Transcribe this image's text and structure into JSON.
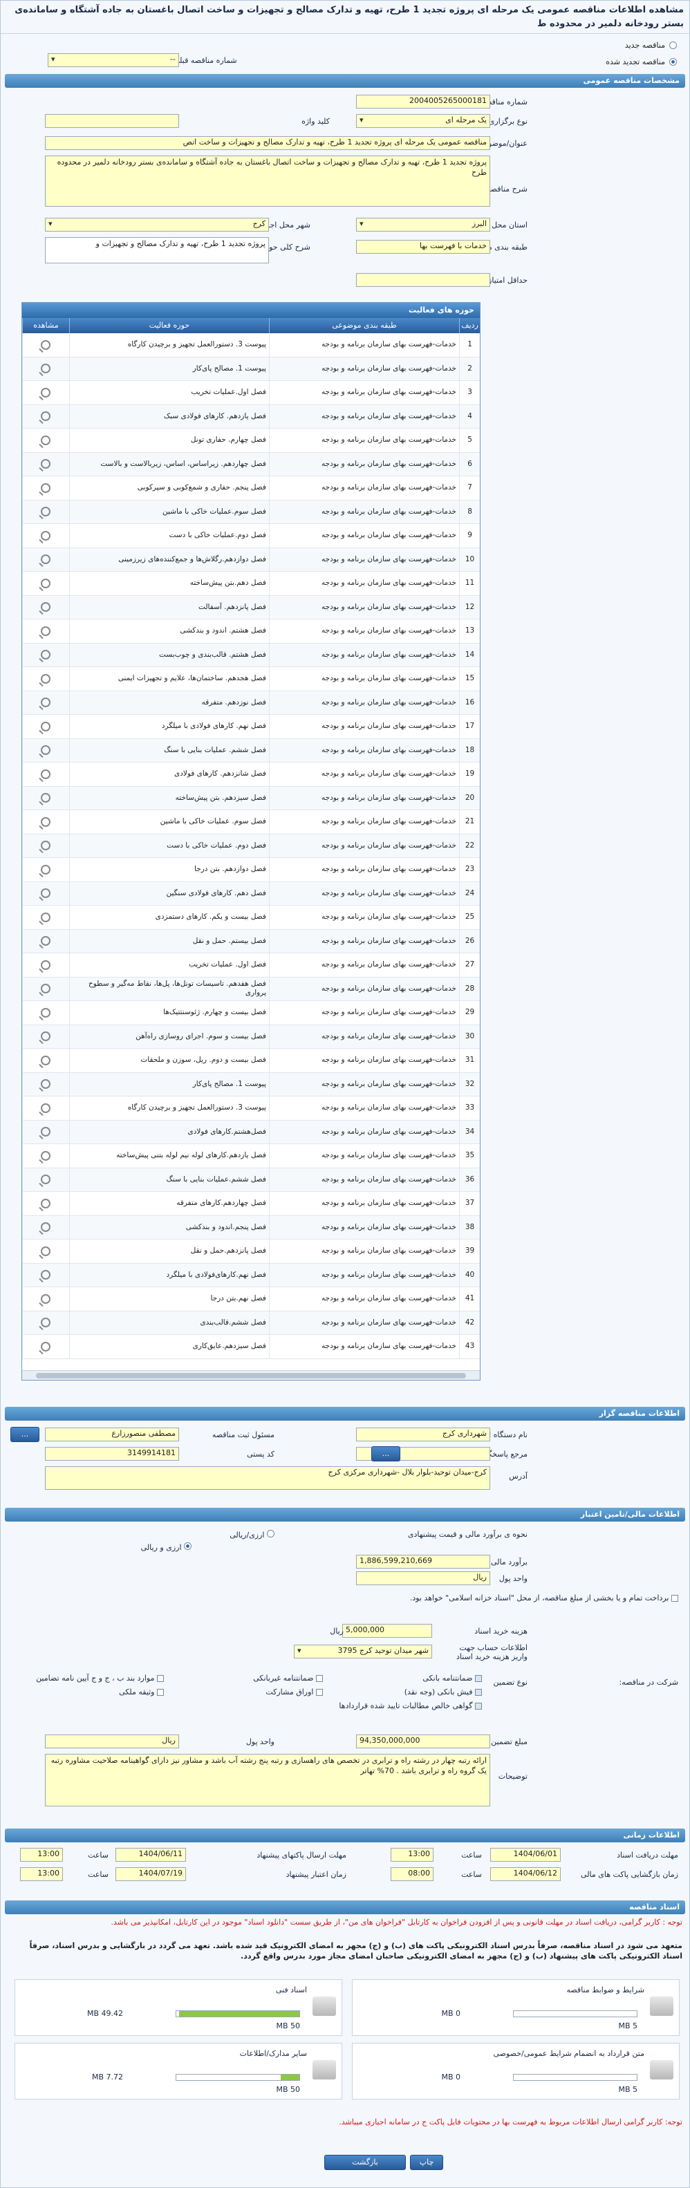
{
  "title": "مشاهده اطلاعات مناقصه عمومی یک مرحله ای پروژه تجدید 1 طرح، تهیه و تدارک مصالح و تجهیزات و ساخت اتصال باغستان به جاده آشتگاه و سامانده‌ی بستر رودخانه دلمیر در محدوده ط",
  "radios": {
    "new": "مناقصه جدید",
    "renewed": "مناقصه تجدید شده",
    "prev_label": "شماره مناقصه قبلی",
    "prev_value": "--"
  },
  "sections": {
    "general": "مشخصات مناقصه عمومی",
    "org": "اطلاعات مناقصه گزار",
    "finance": "اطلاعات مالی/تامین اعتبار",
    "timing": "اطلاعات زمانی",
    "docs": "اسناد مناقصه"
  },
  "general": {
    "number_label": "شماره مناقصه",
    "number": "2004005265000181",
    "type_label": "نوع برگزاری",
    "type": "یک مرحله ای",
    "keyword_label": "کلید واژه",
    "keyword": "",
    "subject_label": "عنوان/موضوع مناقصه",
    "subject": "مناقصه عمومی یک مرحله ای پروژه تجدید 1 طرح، تهیه و تدارک مصالح و تجهیزات و ساخت اتص",
    "desc_label": "شرح مناقصه",
    "desc": "پروژه تجدید 1 طرح، تهیه و تدارک مصالح و تجهیزات و ساخت اتصال باغستان به جاده آشتگاه و سامانده‌ی بستر رودخانه دلمیر در محدوده طرح",
    "province_label": "استان محل اجرا",
    "province": "البرز",
    "city_label": "شهر محل اجرا",
    "city": "کرج",
    "category_label": "طبقه بندی موضوعی",
    "category": "خدمات با فهرست بها",
    "scope_label": "شرح کلی حوزه فعالیت",
    "scope": "پروژه تجدید 1 طرح، تهیه و تدارک مصالح و تجهیزات و",
    "minscore_label": "حداقل امتیاز قابل قبول ارزیابی فنی/بازرگانی",
    "minscore": ""
  },
  "grid": {
    "title": "حوزه های فعالیت",
    "cols": [
      "ردیف",
      "طبقه بندی موضوعی",
      "حوزه فعالیت",
      "مشاهده"
    ],
    "cat": "خدمات-فهرست بهای سازمان برنامه و بودجه",
    "rows": [
      "پیوست 3. دستورالعمل تجهیز و برچیدن کارگاه",
      "پیوست 1. مصالح پای‌کار",
      "فصل اول.عملیات تخریب",
      "فصل یازدهم. کارهای فولادی سبک",
      "فصل چهارم. حفاری تونل",
      "فصل چهاردهم. زیراساس، اساس، زیربالاست و بالاست",
      "فصل پنجم. حفاری و شمع‌کوبی و سپرکوبی",
      "فصل سوم.عملیات خاکی با ماشین",
      "فصل دوم.عملیات خاکی با دست",
      "فصل دوازدهم.رگلاش‌ها و جمع‌کننده‌های زیرزمینی",
      "فصل دهم.بتن پیش‌ساخته",
      "فصل پانزدهم. آسفالت",
      "فصل هشتم. اندود و بندکشی",
      "فصل هشتم. قالب‌بندی و چوب‌بست",
      "فصل هجدهم. ساختمان‌ها، علایم و تجهیزات ایمنی",
      "فصل نوزدهم. متفرقه",
      "فصل نهم. کارهای فولادی با میلگرد",
      "فصل ششم. عملیات بنایی با سنگ",
      "فصل شانزدهم. کارهای فولادی",
      "فصل سیزدهم. بتن پیش‌ساخته",
      "فصل سوم. عملیات خاکی با ماشین",
      "فصل دوم. عملیات خاکی با دست",
      "فصل دوازدهم. بتن درجا",
      "فصل دهم. کارهای فولادی سنگین",
      "فصل بیست و یکم. کارهای دستمزدی",
      "فصل بیستم. حمل و نقل",
      "فصل اول. عملیات تخریب",
      "فصل هفدهم. تاسیسات تونل‌ها، پل‌ها، نقاط مه‌گیر و سطوح پرواری",
      "فصل بیست و چهارم. ژئوسنتتیک‌ها",
      "فصل بیست و سوم. اجرای روسازی راه‌آهن",
      "فصل بیست و دوم. ریل، سوزن و ملحقات",
      "پیوست 1. مصالح پای‌کار",
      "پیوست 3. دستورالعمل تجهیز و برچیدن کارگاه",
      "فصل‌هشتم.کارهای فولادی",
      "فصل یازدهم.کارهای لوله نیم لوله بتنی پیش‌ساخته",
      "فصل ششم.عملیات بنایی با سنگ",
      "فصل چهاردهم.کارهای متفرقه",
      "فصل پنجم.اندود و بندکشی",
      "فصل پانزدهم.حمل و نقل",
      "فصل نهم.کارهای‌فولادی با میلگرد",
      "فصل نهم.بتن درجا",
      "فصل ششم.قالب‌بندی",
      "فصل سیزدهم.عایق‌کاری"
    ]
  },
  "org": {
    "name_label": "نام دستگاه اجرایی مناقصه گزار",
    "name": "شهرداری کرج",
    "resp_label": "مسئول ثبت مناقصه",
    "resp": "مصطفی منصورزارع",
    "ref_label": "مرجع پاسخگویی",
    "ref": "",
    "postal_label": "کد پستی",
    "postal": "3149914181",
    "addr_label": "آدرس",
    "addr": "کرج-میدان توحید-بلوار بلال -شهرداری مرکزی کرج",
    "btn": "..."
  },
  "finance": {
    "method_label": "نحوه ی برآورد مالی و قیمت پیشنهادی",
    "m1": "ارزی/ریالی",
    "m2": "ارزی و ریالی",
    "est_label": "برآورد مالی",
    "est": "1,886,599,210,669",
    "cur_label": "واحد پول",
    "cur": "ریال",
    "note": "برداخت تمام و یا بخشی از مبلغ مناقصه، از محل \"اسناد خزانه اسلامی\" خواهد بود.",
    "fee_label": "هزینه خرید اسناد",
    "fee": "5,000,000",
    "fee_cur": "ریال",
    "acct_label": "اطلاعات حساب جهت واریز هزینه خرید اسناد",
    "acct": "شهر میدان توحید کرج 3795",
    "guar_label": "نوع تضمین",
    "guar_opts": [
      "ضمانتنامه بانکی",
      "ضمانتنامه غیربانکی",
      "موارد بند ب ، ج و ج آیین نامه تضامین",
      "فیش بانکی (وجه نقد)",
      "اوراق مشارکت",
      "وثیقه ملکی",
      "گواهی خالص مطالبات تایید شده قراردادها"
    ],
    "share_label": "شرکت در مناقصه:",
    "amt_label": "مبلغ تضمین",
    "amt": "94,350,000,000",
    "amt_cur_label": "واحد پول",
    "amt_cur": "ریال",
    "expl_label": "توضیحات",
    "expl": "ارائه رتبه چهار در رشته راه و ترابری در تخصص های راهسازی و رتبه پنج رشته آب باشد و مشاور نیز دارای گواهینامه صلاحیت مشاوره رتبه یک گروه راه و ترابری باشد . 70% تهاتر"
  },
  "timing": {
    "recv_label": "مهلت دریافت اسناد",
    "recv_date": "1404/06/01",
    "recv_time": "13:00",
    "send_label": "مهلت ارسال پاکتهای پیشنهاد",
    "send_date": "1404/06/11",
    "send_time": "13:00",
    "open_label": "زمان بازگشایی پاکت های مالی",
    "open_date": "1404/06/12",
    "open_time": "08:00",
    "valid_label": "زمان اعتبار پیشنهاد",
    "valid_date": "1404/07/19",
    "valid_time": "13:00",
    "time_label": "ساعت"
  },
  "docs": {
    "note1": "توجه : کاربر گرامی، دریافت اسناد در مهلت قانونی و پس از افزودن فراخوان به کارتابل \"فراخوان های من\"، از طریق سست \"دانلود اسناد\" موجود در این کارتابل، امکانپذیر می باشد.",
    "note2": "متعهد می شود در اسناد مناقصه، صرفاً بدرس اسناد الکترونیکی پاکت های (ب) و (ج) مجهز به امضای الکترونیک قید شده باشد. تعهد می گردد در بارگشایی و بدرس اسناد، صرفاً اسناد الکترونیکی پاکت های پیشنهاد (ب) و (ج) مجهز به امضای الکترونیکی صاحبان امضای مجاز مورد بدرس واقع گردد.",
    "box1_label": "شرایط و ضوابط مناقصه",
    "box1_used": "0 MB",
    "box1_max": "5 MB",
    "box1_fill": 0,
    "box2_label": "اسناد فنی",
    "box2_used": "49.42 MB",
    "box2_max": "50 MB",
    "box2_fill": 0.98,
    "box3_label": "متن قرارداد به انضمام شرایط عمومی/خصوصی",
    "box3_used": "0 MB",
    "box3_max": "5 MB",
    "box3_fill": 0,
    "box4_label": "سایر مدارک/اطلاعات",
    "box4_used": "7.72 MB",
    "box4_max": "50 MB",
    "box4_fill": 0.15,
    "note3": "توجه: کاربر گرامی ارسال اطلاعات مربوط به فهرست بها در محتویات فایل پاکت ج در سامانه اجباری میباشد."
  },
  "buttons": {
    "back": "بازگشت",
    "print": "چاپ"
  }
}
